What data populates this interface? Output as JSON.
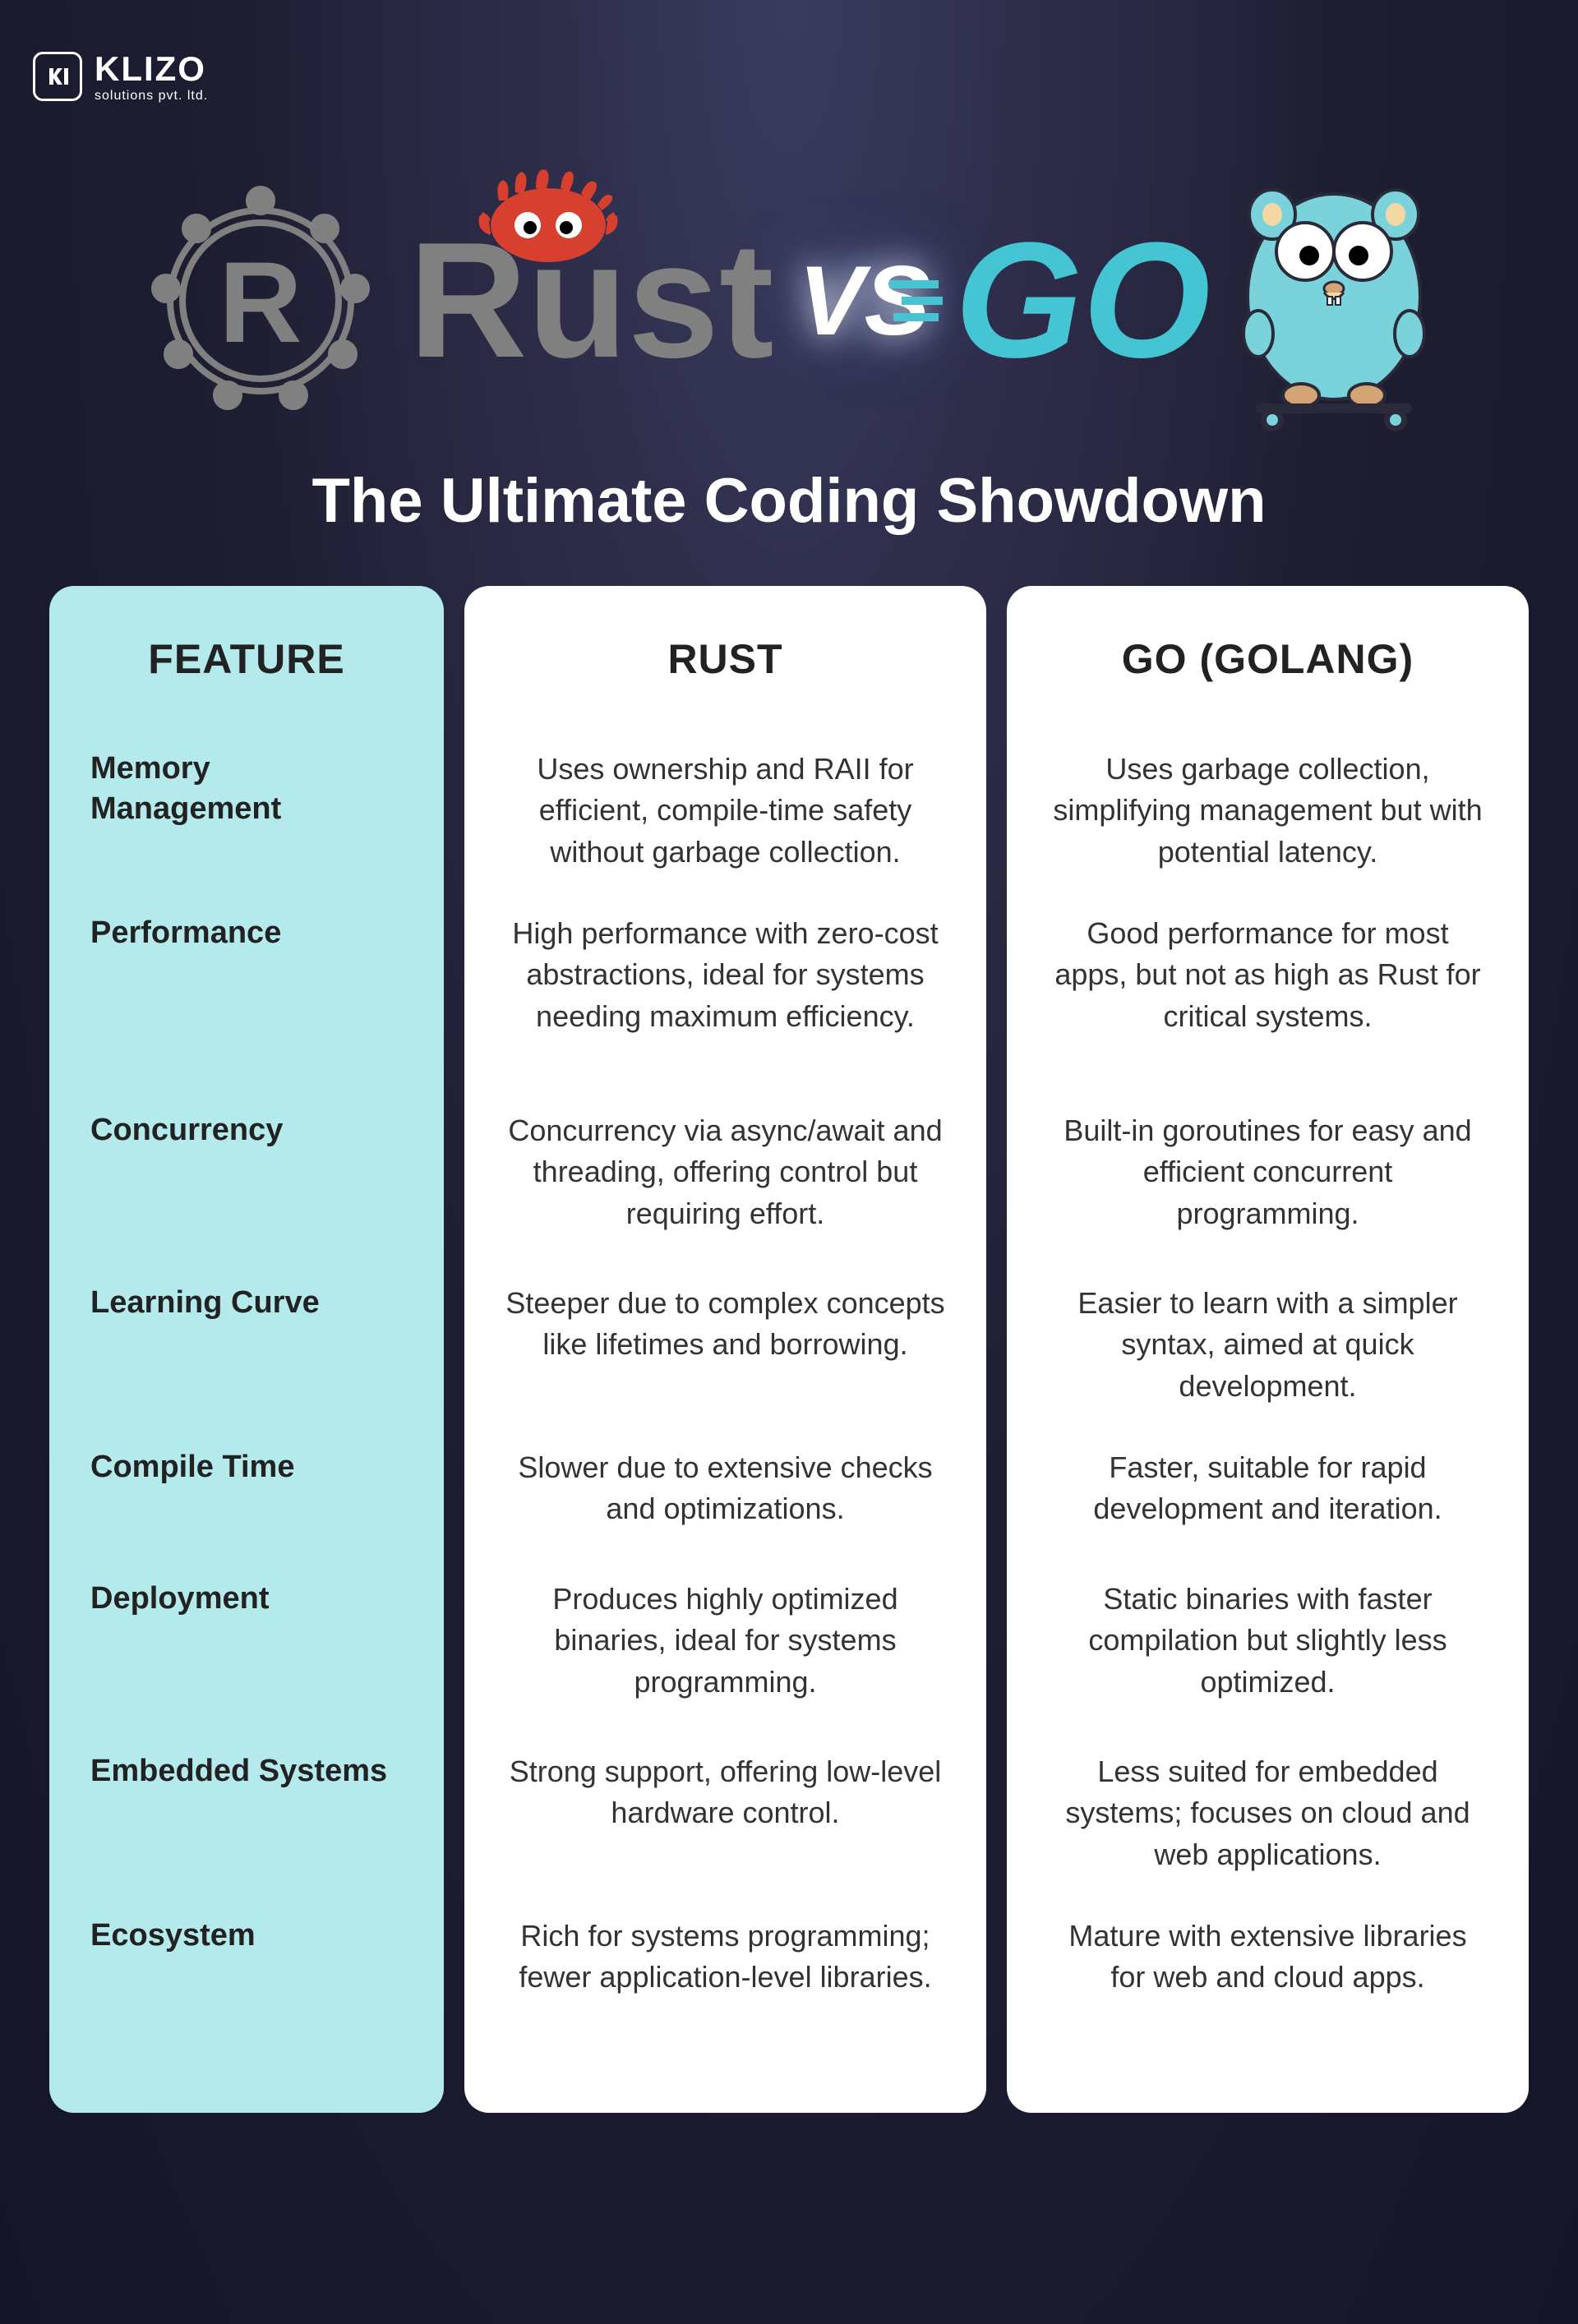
{
  "logo": {
    "name": "KLIZO",
    "tagline": "solutions pvt. ltd.",
    "icon_letter": "KI"
  },
  "hero": {
    "rust": "Rust",
    "vs": "VS",
    "go": "GO",
    "subtitle": "The Ultimate Coding Showdown"
  },
  "headers": {
    "feature": "FEATURE",
    "rust": "RUST",
    "go": "GO (GOLANG)"
  },
  "rows": [
    {
      "feature": "Memory Management",
      "rust": "Uses ownership and RAII for efficient, compile-time safety without garbage collection.",
      "go": "Uses garbage collection, simplifying management but with potential latency."
    },
    {
      "feature": "Performance",
      "rust": "High performance with zero-cost abstractions, ideal for systems needing maximum efficiency.",
      "go": "Good performance for most apps, but not as high as Rust for critical systems."
    },
    {
      "feature": "Concurrency",
      "rust": "Concurrency via async/await and threading, offering control but requiring effort.",
      "go": "Built-in goroutines for easy and efficient concurrent programming."
    },
    {
      "feature": "Learning Curve",
      "rust": "Steeper due to complex concepts like lifetimes and borrowing.",
      "go": "Easier to learn with a simpler syntax, aimed at quick development."
    },
    {
      "feature": "Compile Time",
      "rust": "Slower due to extensive checks and optimizations.",
      "go": "Faster, suitable for rapid development and iteration."
    },
    {
      "feature": "Deployment",
      "rust": "Produces highly optimized binaries, ideal for systems programming.",
      "go": "Static binaries with faster compilation but slightly less optimized."
    },
    {
      "feature": "Embedded Systems",
      "rust": "Strong support, offering low-level hardware control.",
      "go": "Less suited for embedded systems; focuses on cloud and web applications."
    },
    {
      "feature": "Ecosystem",
      "rust": "Rich for systems programming; fewer application-level libraries.",
      "go": "Mature with extensive libraries for web and cloud apps."
    }
  ]
}
